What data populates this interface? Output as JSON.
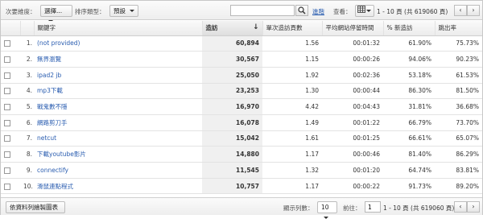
{
  "toolbar": {
    "secondary_dimension_label": "次要維度：",
    "secondary_dimension_value": "選擇...",
    "sort_type_label": "排序類型：",
    "sort_type_value": "預設",
    "search_placeholder": "",
    "advanced_label": "進階",
    "view_label": "查看：",
    "range_text": "1 - 10 頁 (共 619060 頁)"
  },
  "columns": [
    "關鍵字",
    "造訪",
    "單次造訪頁數",
    "平均網站停留時間",
    "% 新造訪",
    "跳出率"
  ],
  "rows": [
    {
      "idx": "1.",
      "keyword": "(not provided)",
      "visits": "60,894",
      "ppv": "1.56",
      "avg_time": "00:01:32",
      "new": "61.90%",
      "bounce": "75.73%"
    },
    {
      "idx": "2.",
      "keyword": "無界瀏覽",
      "visits": "30,567",
      "ppv": "1.15",
      "avg_time": "00:00:26",
      "new": "94.06%",
      "bounce": "90.23%"
    },
    {
      "idx": "3.",
      "keyword": "ipad2 jb",
      "visits": "25,050",
      "ppv": "1.92",
      "avg_time": "00:02:36",
      "new": "53.18%",
      "bounce": "61.53%"
    },
    {
      "idx": "4.",
      "keyword": "mp3下載",
      "visits": "23,253",
      "ppv": "1.30",
      "avg_time": "00:00:44",
      "new": "86.30%",
      "bounce": "81.50%"
    },
    {
      "idx": "5.",
      "keyword": "戰鬼數不隱",
      "visits": "16,970",
      "ppv": "4.42",
      "avg_time": "00:04:43",
      "new": "31.81%",
      "bounce": "36.68%"
    },
    {
      "idx": "6.",
      "keyword": "網路剪刀手",
      "visits": "16,078",
      "ppv": "1.49",
      "avg_time": "00:01:22",
      "new": "66.79%",
      "bounce": "73.70%"
    },
    {
      "idx": "7.",
      "keyword": "netcut",
      "visits": "15,042",
      "ppv": "1.61",
      "avg_time": "00:01:25",
      "new": "66.61%",
      "bounce": "65.07%"
    },
    {
      "idx": "8.",
      "keyword": "下載youtube影片",
      "visits": "14,880",
      "ppv": "1.17",
      "avg_time": "00:00:46",
      "new": "81.40%",
      "bounce": "86.29%"
    },
    {
      "idx": "9.",
      "keyword": "connectify",
      "visits": "11,545",
      "ppv": "1.32",
      "avg_time": "00:01:20",
      "new": "64.74%",
      "bounce": "83.81%"
    },
    {
      "idx": "10.",
      "keyword": "滑鼠連點程式",
      "visits": "10,757",
      "ppv": "1.17",
      "avg_time": "00:00:22",
      "new": "91.73%",
      "bounce": "89.20%"
    }
  ],
  "footer": {
    "chart_button": "依資料列繪製圖表",
    "rows_label": "顯示列數：",
    "rows_value": "10",
    "goto_label": "前往：",
    "goto_value": "1",
    "range_text": "1 - 10 頁 (共 619060 頁)"
  },
  "icons": {
    "sort_arrow": "down-arrow-icon",
    "prev": "chevron-left-icon",
    "next": "chevron-right-icon"
  }
}
